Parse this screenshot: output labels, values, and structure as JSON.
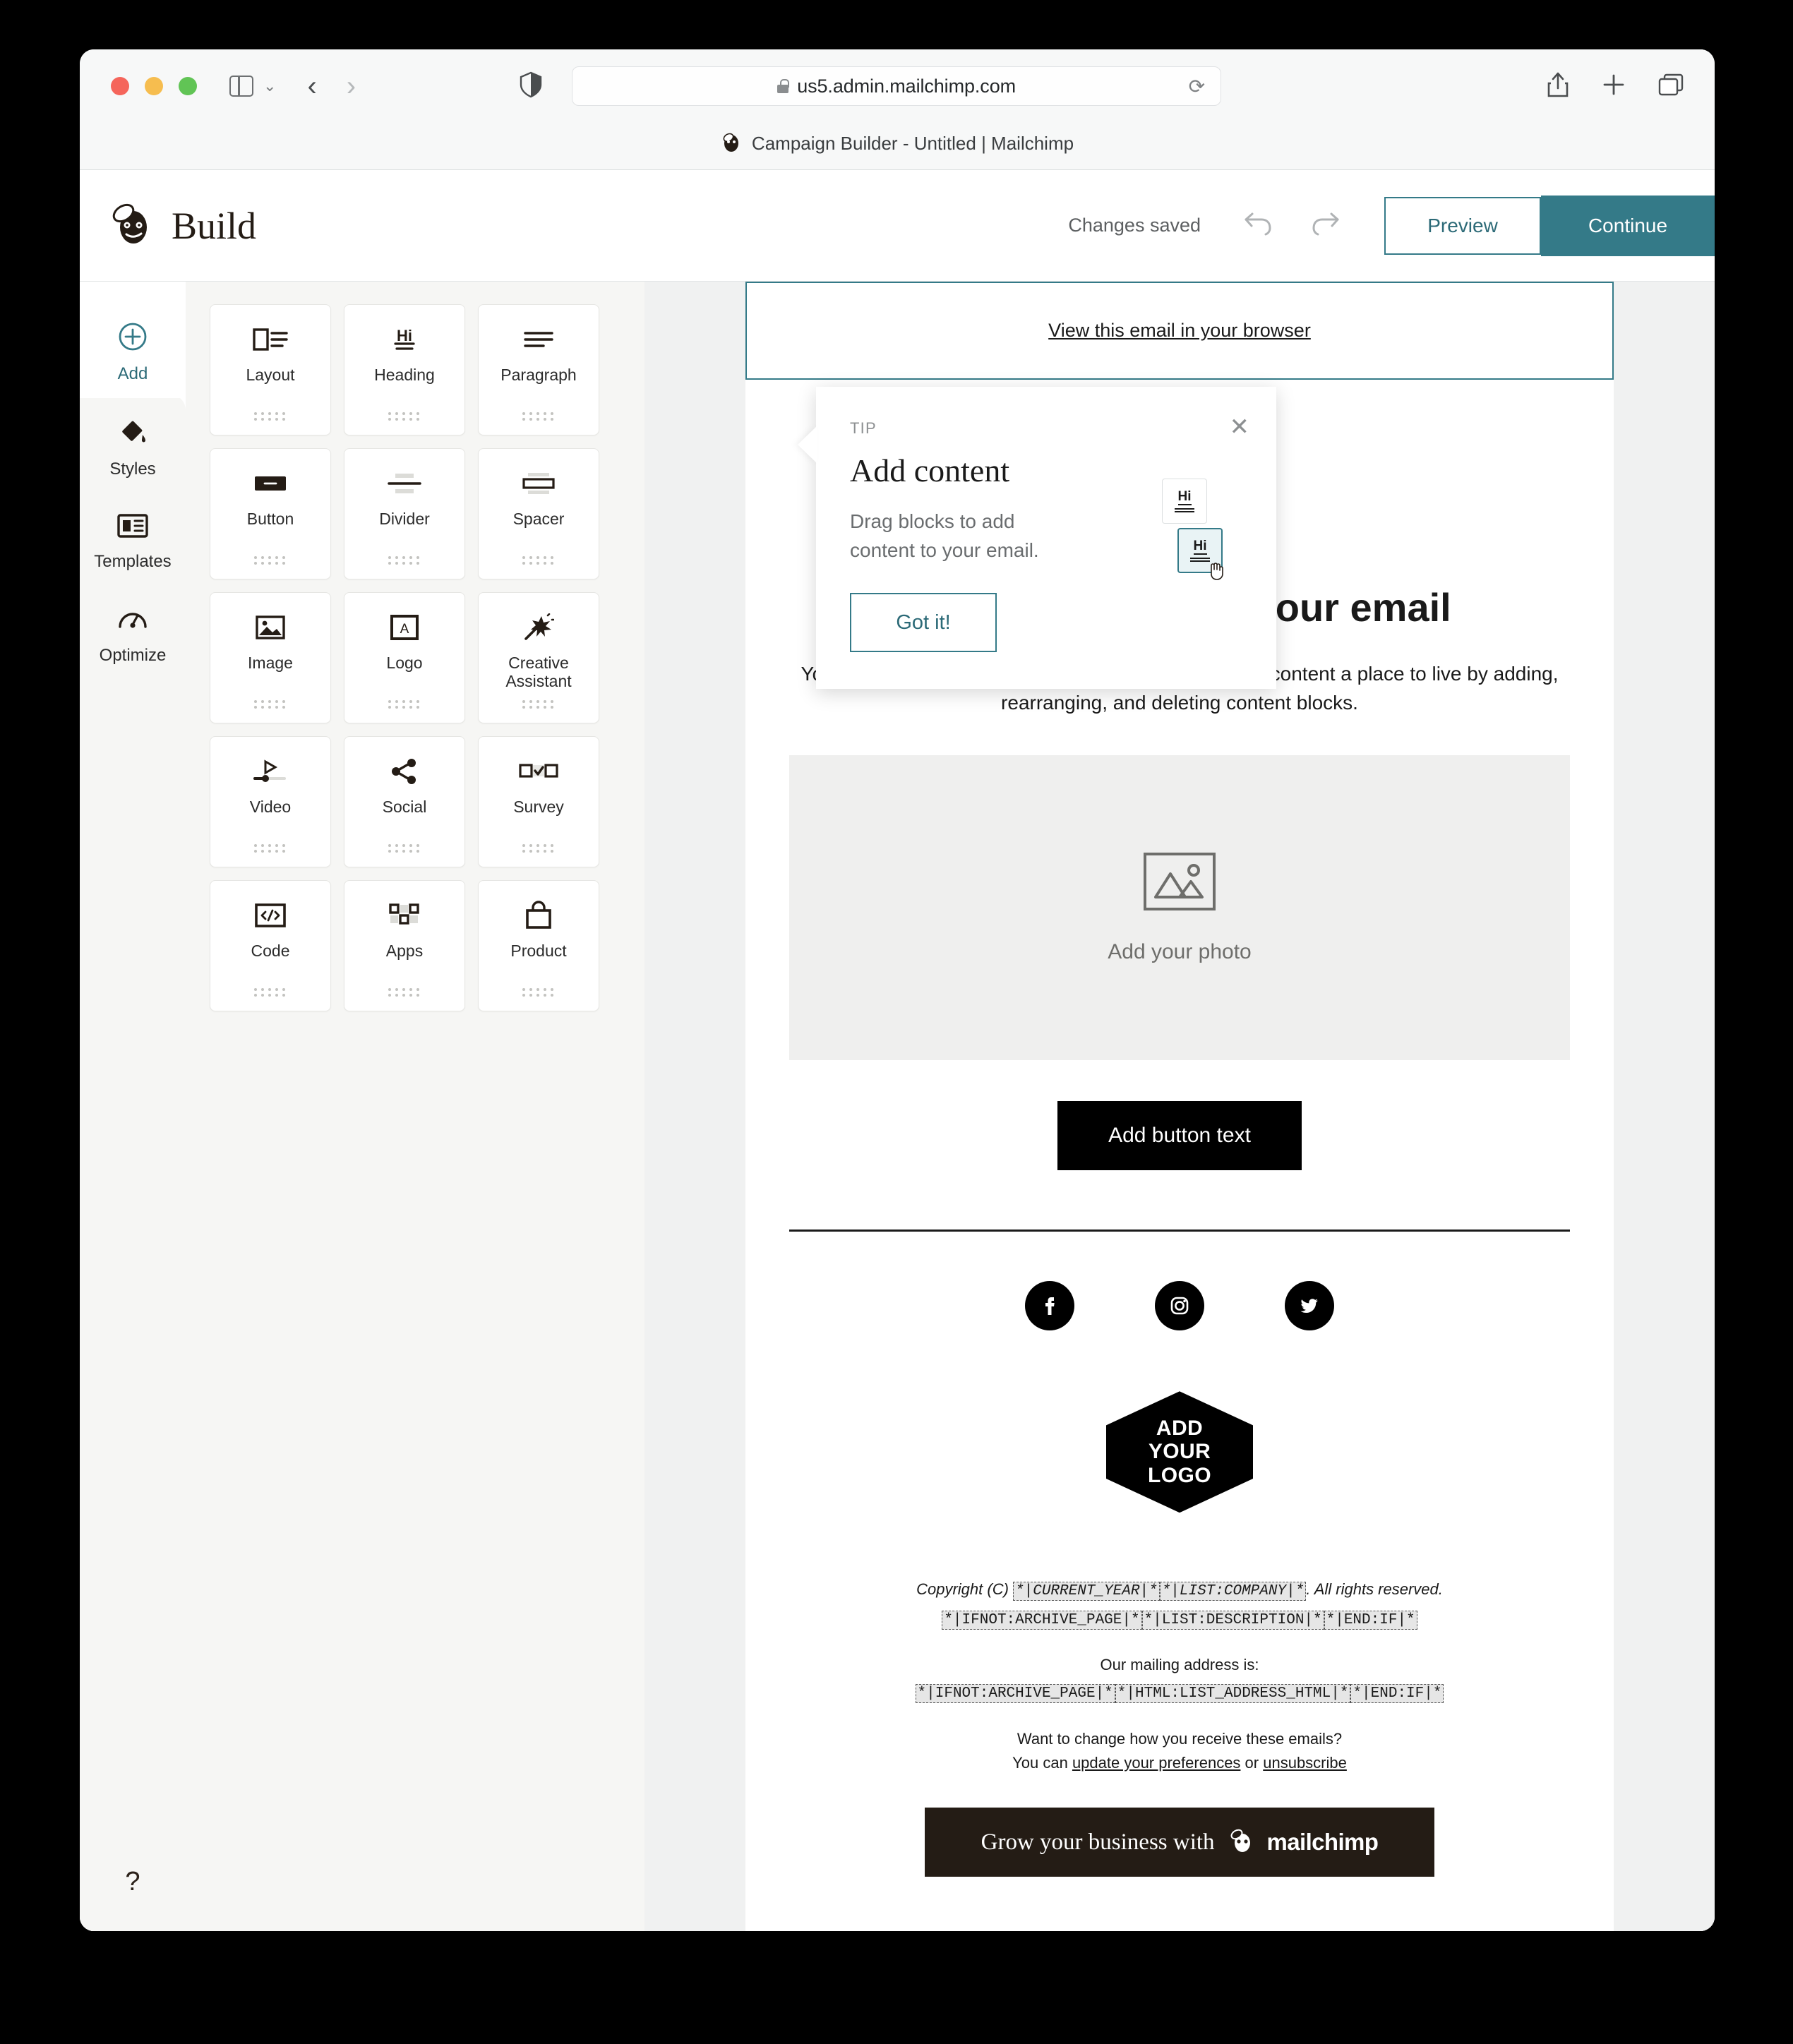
{
  "browser": {
    "url": "us5.admin.mailchimp.com",
    "tab_title": "Campaign Builder - Untitled | Mailchimp",
    "reload_icon": "reload-icon",
    "share_icon": "share-icon",
    "new_tab_icon": "plus-icon",
    "tabs_icon": "tabs-overview-icon",
    "shield_icon": "privacy-shield-icon",
    "back_icon": "back-chevron-icon",
    "forward_icon": "forward-chevron-icon",
    "sidebar_icon": "sidebar-toggle-icon"
  },
  "header": {
    "title": "Build",
    "logo": "mailchimp-freddie-logo",
    "status": "Changes saved",
    "undo_icon": "undo-arrow-icon",
    "redo_icon": "redo-arrow-icon",
    "preview_label": "Preview",
    "continue_label": "Continue",
    "accent_color": "#347A88"
  },
  "rail": {
    "items": [
      {
        "label": "Add",
        "icon": "plus-circle-icon",
        "active": true
      },
      {
        "label": "Styles",
        "icon": "paint-bucket-icon",
        "active": false
      },
      {
        "label": "Templates",
        "icon": "templates-layout-icon",
        "active": false
      },
      {
        "label": "Optimize",
        "icon": "gauge-icon",
        "active": false
      }
    ],
    "help_label": "?"
  },
  "blocks": [
    {
      "label": "Layout",
      "icon": "layout-icon"
    },
    {
      "label": "Heading",
      "icon": "heading-hi-icon"
    },
    {
      "label": "Paragraph",
      "icon": "paragraph-lines-icon"
    },
    {
      "label": "Button",
      "icon": "button-icon"
    },
    {
      "label": "Divider",
      "icon": "divider-icon"
    },
    {
      "label": "Spacer",
      "icon": "spacer-icon"
    },
    {
      "label": "Image",
      "icon": "image-icon"
    },
    {
      "label": "Logo",
      "icon": "logo-letter-a-icon"
    },
    {
      "label": "Creative Assistant",
      "icon": "magic-wand-icon"
    },
    {
      "label": "Video",
      "icon": "video-play-icon"
    },
    {
      "label": "Social",
      "icon": "share-nodes-icon"
    },
    {
      "label": "Survey",
      "icon": "survey-checkbox-icon"
    },
    {
      "label": "Code",
      "icon": "code-brackets-icon"
    },
    {
      "label": "Apps",
      "icon": "apps-grid-icon"
    },
    {
      "label": "Product",
      "icon": "shopping-bag-icon"
    }
  ],
  "tip": {
    "kicker": "TIP",
    "title": "Add content",
    "body": "Drag blocks to add content to your email.",
    "button_label": "Got it!",
    "close_icon": "close-icon",
    "art_label": "Hi"
  },
  "email": {
    "preheader_link": "View this email in your browser",
    "logo_lines": [
      "ADD",
      "YOUR",
      "LOGO"
    ],
    "heading": "It's time to design your email",
    "paragraph": "You can define the layout of your email and give your content a place to live by adding, rearranging, and deleting content blocks.",
    "photo_placeholder": "Add your photo",
    "photo_icon": "image-placeholder-icon",
    "button_label": "Add button text",
    "socials": [
      {
        "name": "facebook-icon"
      },
      {
        "name": "instagram-icon"
      },
      {
        "name": "twitter-icon"
      }
    ],
    "footer": {
      "copyright_prefix": "Copyright (C) ",
      "merge_current_year": "*|CURRENT_YEAR|*",
      "merge_list_company": "*|LIST:COMPANY|*",
      "copyright_suffix": ". All rights reserved.",
      "merge_ifnot_archive": "*|IFNOT:ARCHIVE_PAGE|*",
      "merge_list_description": "*|LIST:DESCRIPTION|*",
      "merge_endif": "*|END:IF|*",
      "mailing_label": "Our mailing address is:",
      "merge_ifnot_archive2": "*|IFNOT:ARCHIVE_PAGE|*",
      "merge_address_html": "*|HTML:LIST_ADDRESS_HTML|*",
      "merge_endif2": "*|END:IF|*",
      "change_line": "Want to change how you receive these emails?",
      "you_can": "You can ",
      "update_link": "update your preferences",
      "or_text": " or ",
      "unsubscribe_link": "unsubscribe",
      "promo_text": "Grow your business with",
      "promo_brand": "mailchimp"
    }
  }
}
